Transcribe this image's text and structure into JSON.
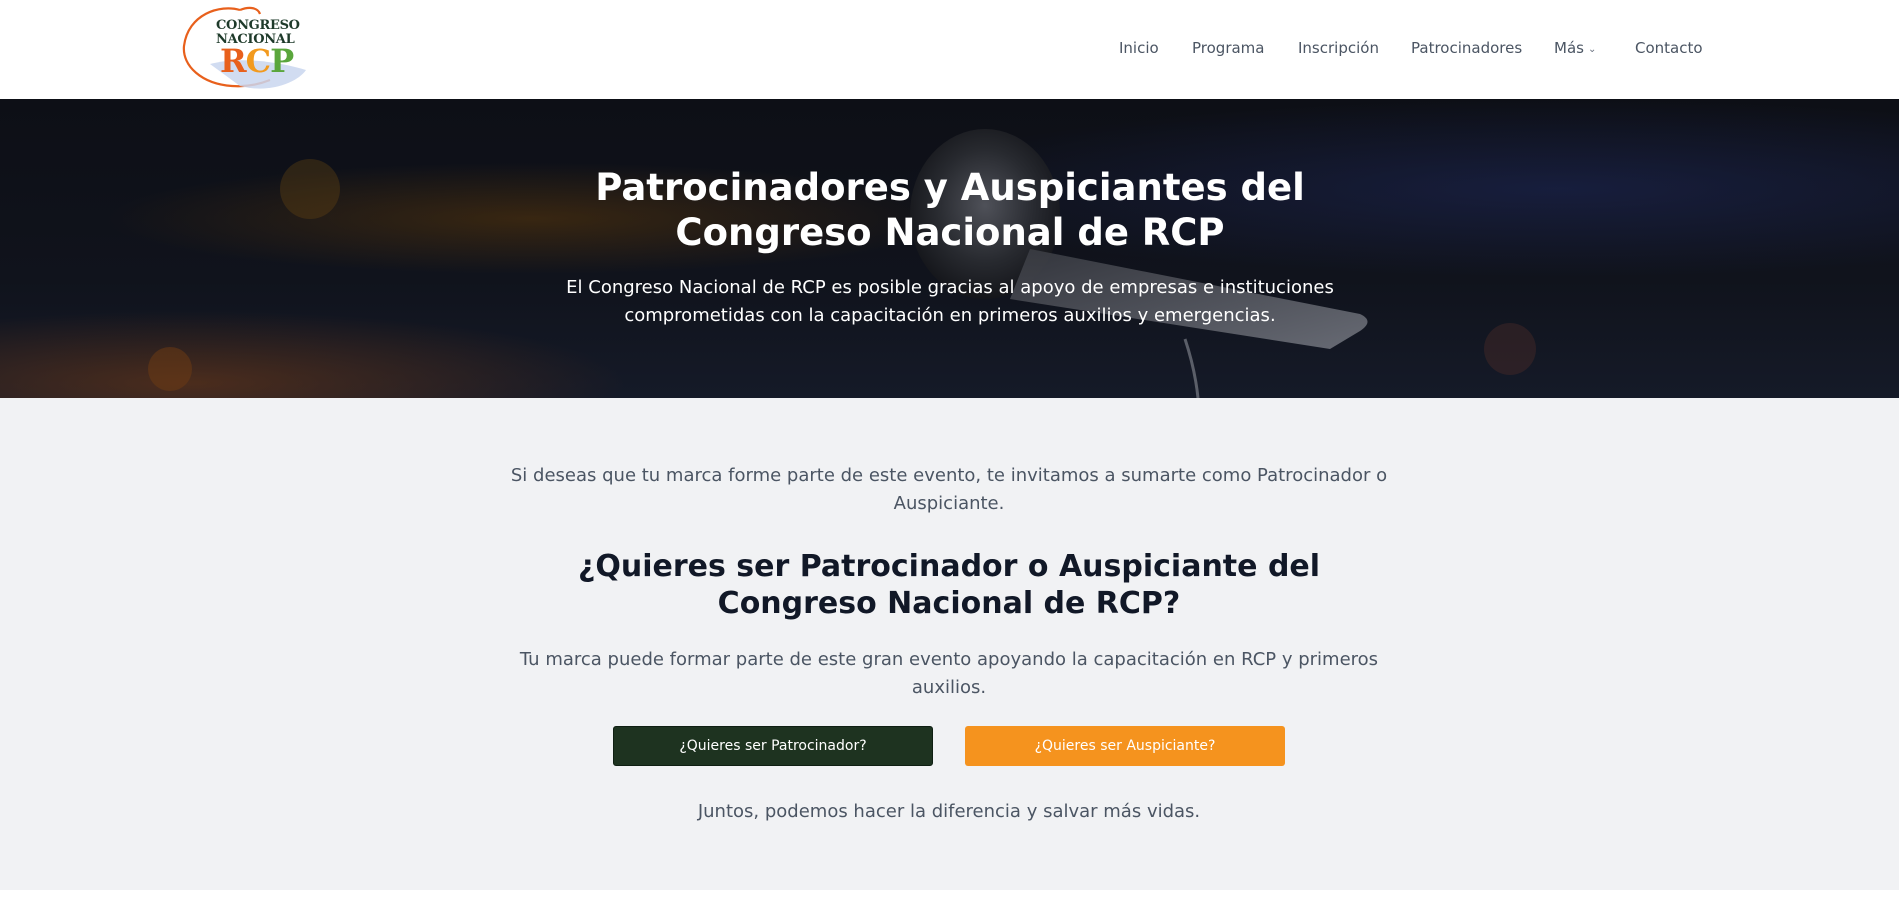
{
  "header": {
    "logo": {
      "line1": "CONGRESO",
      "line2": "NACIONAL",
      "rcp_r": "R",
      "rcp_c": "C",
      "rcp_p": "P"
    },
    "nav": [
      {
        "label": "Inicio"
      },
      {
        "label": "Programa"
      },
      {
        "label": "Inscripción"
      },
      {
        "label": "Patrocinadores"
      },
      {
        "label": "Más",
        "icon": "chevron-down-icon"
      },
      {
        "label": "Contacto"
      }
    ]
  },
  "hero": {
    "title": "Patrocinadores y Auspiciantes del Congreso Nacional de RCP",
    "subtitle": "El Congreso Nacional de RCP es posible gracias al apoyo de empresas e instituciones comprometidas con la capacitación en primeros auxilios y emergencias."
  },
  "main": {
    "invite_text": "Si deseas que tu marca forme parte de este evento, te invitamos a sumarte como Patrocinador o Auspiciante.",
    "question": "¿Quieres ser Patrocinador o Auspiciante del Congreso Nacional de RCP?",
    "brand_text": "Tu marca puede formar parte de este gran evento apoyando la capacitación en RCP y primeros auxilios.",
    "button_patrocinador": "¿Quieres ser Patrocinador?",
    "button_auspiciante": "¿Quieres ser Auspiciante?",
    "closing_text": "Juntos, podemos hacer la diferencia y salvar más vidas."
  },
  "colors": {
    "patrocinador_button": "#1e3320",
    "auspiciante_button": "#f5931e",
    "section_bg": "#f1f2f4",
    "logo_orange": "#e8601c",
    "logo_green": "#5aa63c"
  }
}
